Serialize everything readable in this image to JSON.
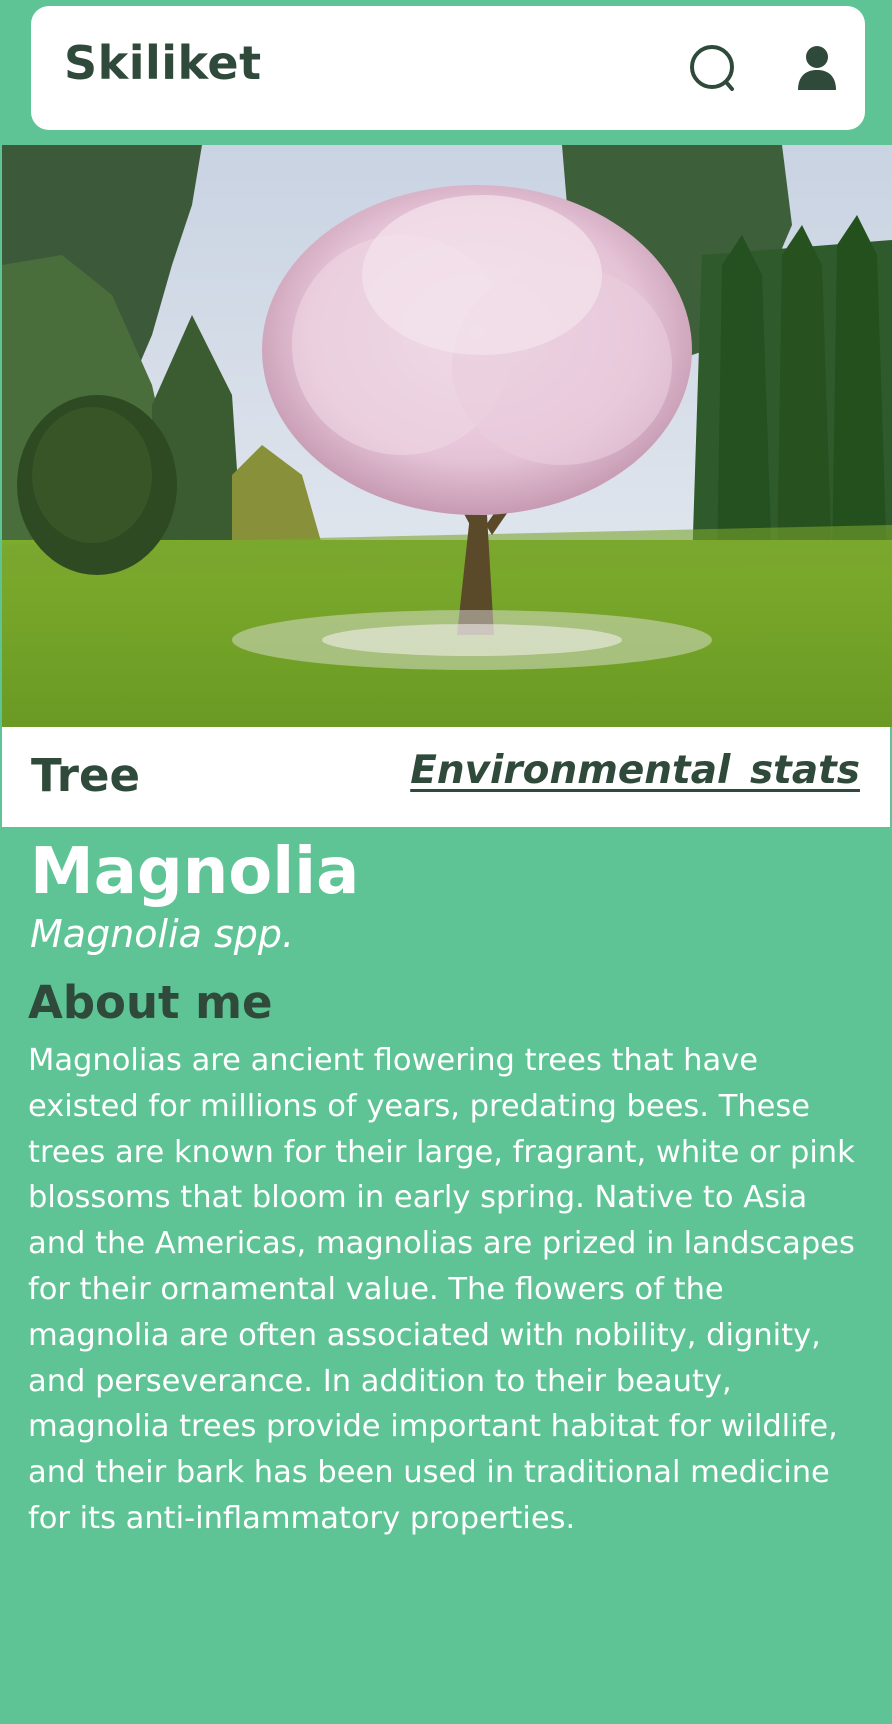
{
  "header": {
    "app_title": "Skiliket",
    "search_icon": "search-icon",
    "account_icon": "account-icon"
  },
  "hero_image": {
    "alt": "Magnolia tree in bloom"
  },
  "plant": {
    "type": "Tree",
    "stats_link": "Environmental stats",
    "name": "Magnolia",
    "scientific_name": "Magnolia spp.",
    "about_heading": "About me",
    "description": "Magnolias are ancient flowering trees that have existed for millions of years, predating bees. These trees are known for their large, fragrant, white or pink blossoms that bloom in early spring. Native to Asia and the Americas, magnolias are prized in landscapes for their ornamental value. The flowers of the magnolia are often associated with nobility, dignity, and perseverance. In addition to their beauty, magnolia trees provide important habitat for wildlife, and their bark has been used in traditional medicine for its anti-inflammatory properties."
  },
  "colors": {
    "background": "#5ec495",
    "header_bg": "#ffffff",
    "dark_text": "#2f4a3a",
    "light_text": "#ffffff"
  }
}
